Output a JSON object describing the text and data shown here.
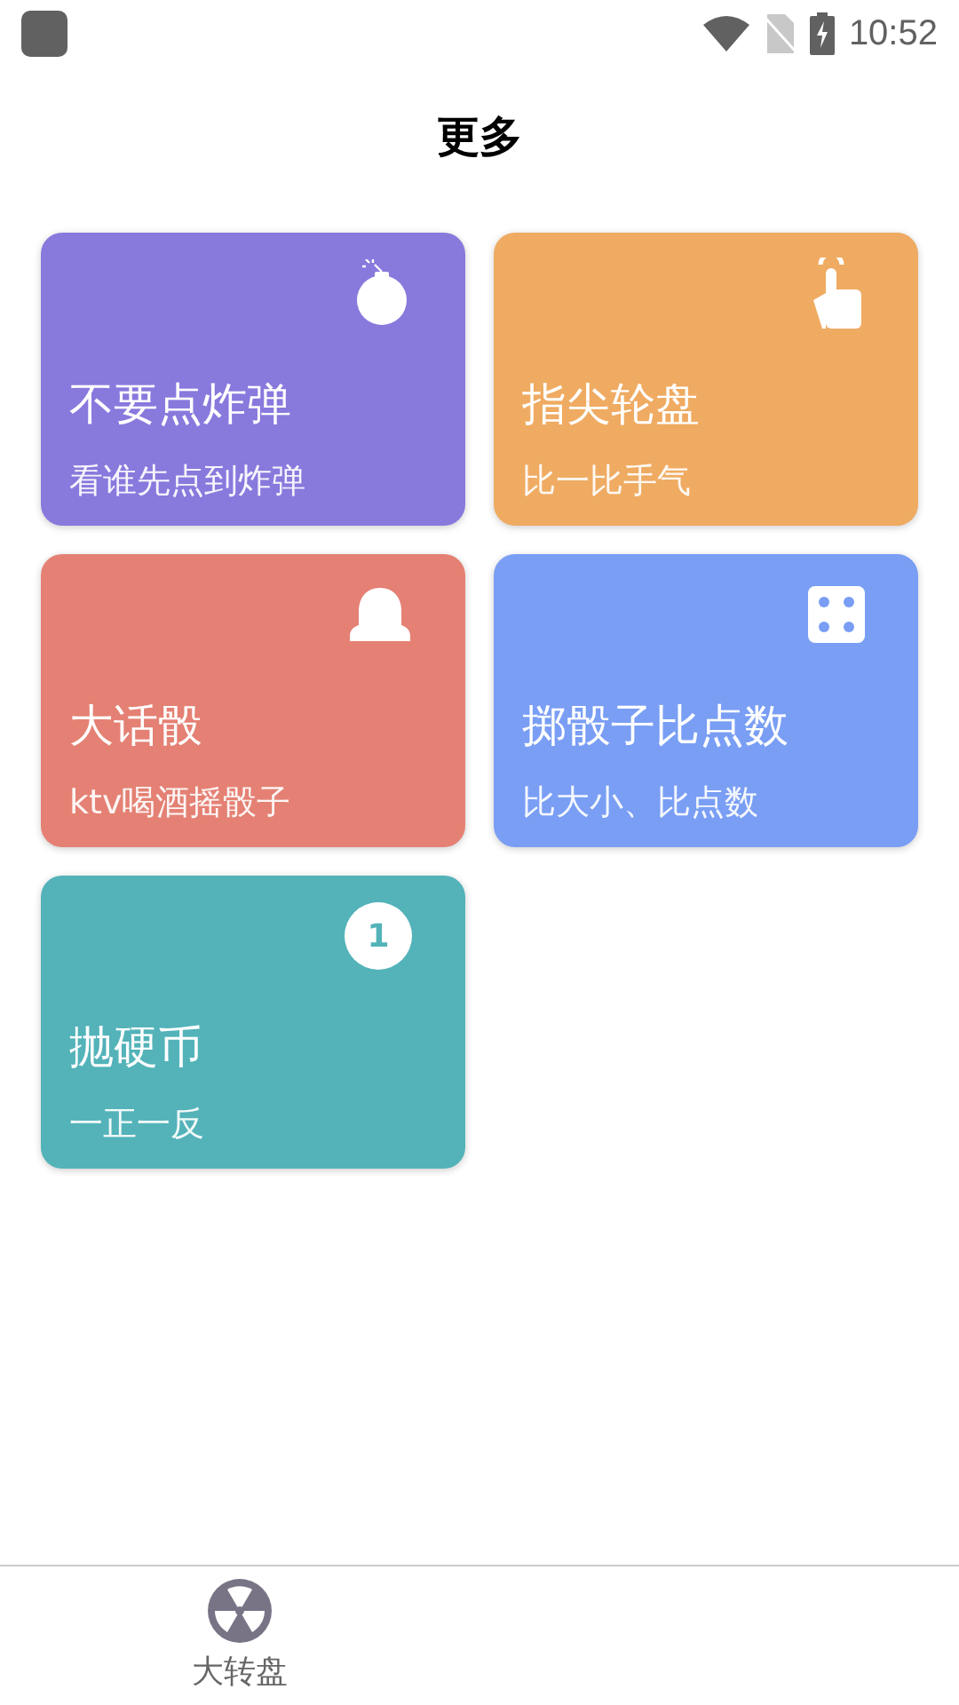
{
  "status_bar": {
    "time": "10:52"
  },
  "header": {
    "title": "更多"
  },
  "cards": [
    {
      "title": "不要点炸弹",
      "subtitle": "看谁先点到炸弹",
      "color": "#8879dd",
      "kind": "bomb"
    },
    {
      "title": "指尖轮盘",
      "subtitle": "比一比手气",
      "color": "#efab62",
      "kind": "finger"
    },
    {
      "title": "大话骰",
      "subtitle": "ktv喝酒摇骰子",
      "color": "#e48174",
      "kind": "cup"
    },
    {
      "title": "掷骰子比点数",
      "subtitle": "比大小、比点数",
      "color": "#799ef4",
      "kind": "dice"
    },
    {
      "title": "抛硬币",
      "subtitle": "一正一反",
      "color": "#53b3b9",
      "kind": "coin",
      "badge": "1"
    }
  ],
  "bottom_nav": [
    {
      "label": "大转盘",
      "selected": false
    }
  ]
}
